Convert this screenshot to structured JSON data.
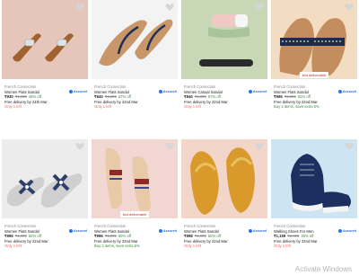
{
  "colors": {
    "heart": "#d6d6d6",
    "assured": "#2874f0",
    "discount": "#388e3c",
    "stock": "#ff6161"
  },
  "products": [
    {
      "brand": "French Connection",
      "title": "Women Flats Sandal",
      "price": "₹930",
      "mrp": "₹1,980",
      "off": "45% off",
      "delivery": "Free delivery by 24th Mar",
      "extra": "Only 1 left",
      "extra_type": "stock",
      "badge": "",
      "assured": "Assured"
    },
    {
      "brand": "French Connection",
      "title": "Women Flats Sandal",
      "price": "₹840",
      "mrp": "₹1,599",
      "off": "57% off",
      "delivery": "Free delivery by 22nd Mar",
      "extra": "Only 1 left",
      "extra_type": "stock",
      "badge": "",
      "assured": "Assured"
    },
    {
      "brand": "French Connection",
      "title": "Women Casual Sandal",
      "price": "₹840",
      "mrp": "₹1,899",
      "off": "57% off",
      "delivery": "Free delivery by 22nd Mar",
      "extra": "Only 1 left",
      "extra_type": "stock",
      "badge": "",
      "assured": "Assured"
    },
    {
      "brand": "French Connection",
      "title": "Women Flats Sandal",
      "price": "₹996",
      "mrp": "₹2,099",
      "off": "52% off",
      "delivery": "Free delivery by 22nd Mar",
      "extra": "Buy 2 items, save extra 5%",
      "extra_type": "offer",
      "badge": "Not deliverable",
      "assured": "Assured"
    },
    {
      "brand": "French Connection",
      "title": "Women Flats Sandal",
      "price": "₹996",
      "mrp": "₹1,999",
      "off": "50% off",
      "delivery": "Free delivery by 22nd Mar",
      "extra": "Only 1 left",
      "extra_type": "stock",
      "badge": "",
      "assured": "Assured"
    },
    {
      "brand": "French Connection",
      "title": "Women Flats Sandal",
      "price": "₹996",
      "mrp": "₹1,999",
      "off": "50% off",
      "delivery": "Free delivery by 22nd Mar",
      "extra": "Buy 2 items, save extra 5%",
      "extra_type": "offer",
      "badge": "Not deliverable",
      "assured": "Assured"
    },
    {
      "brand": "French Connection",
      "title": "Women Flats Sandal",
      "price": "₹998",
      "mrp": "₹1,999",
      "off": "50% off",
      "delivery": "Free delivery by 22nd Mar",
      "extra": "Only 1 left",
      "extra_type": "stock",
      "badge": "",
      "assured": "Assured"
    },
    {
      "brand": "French Connection",
      "title": "Walking Shoes For Men",
      "price": "₹1,159",
      "mrp": "₹2,099",
      "off": "45% off",
      "delivery": "Free delivery by 22nd Mar",
      "extra": "Only 1 left",
      "extra_type": "stock",
      "badge": "",
      "assured": "Assured"
    }
  ],
  "watermark": "Activate Windows"
}
